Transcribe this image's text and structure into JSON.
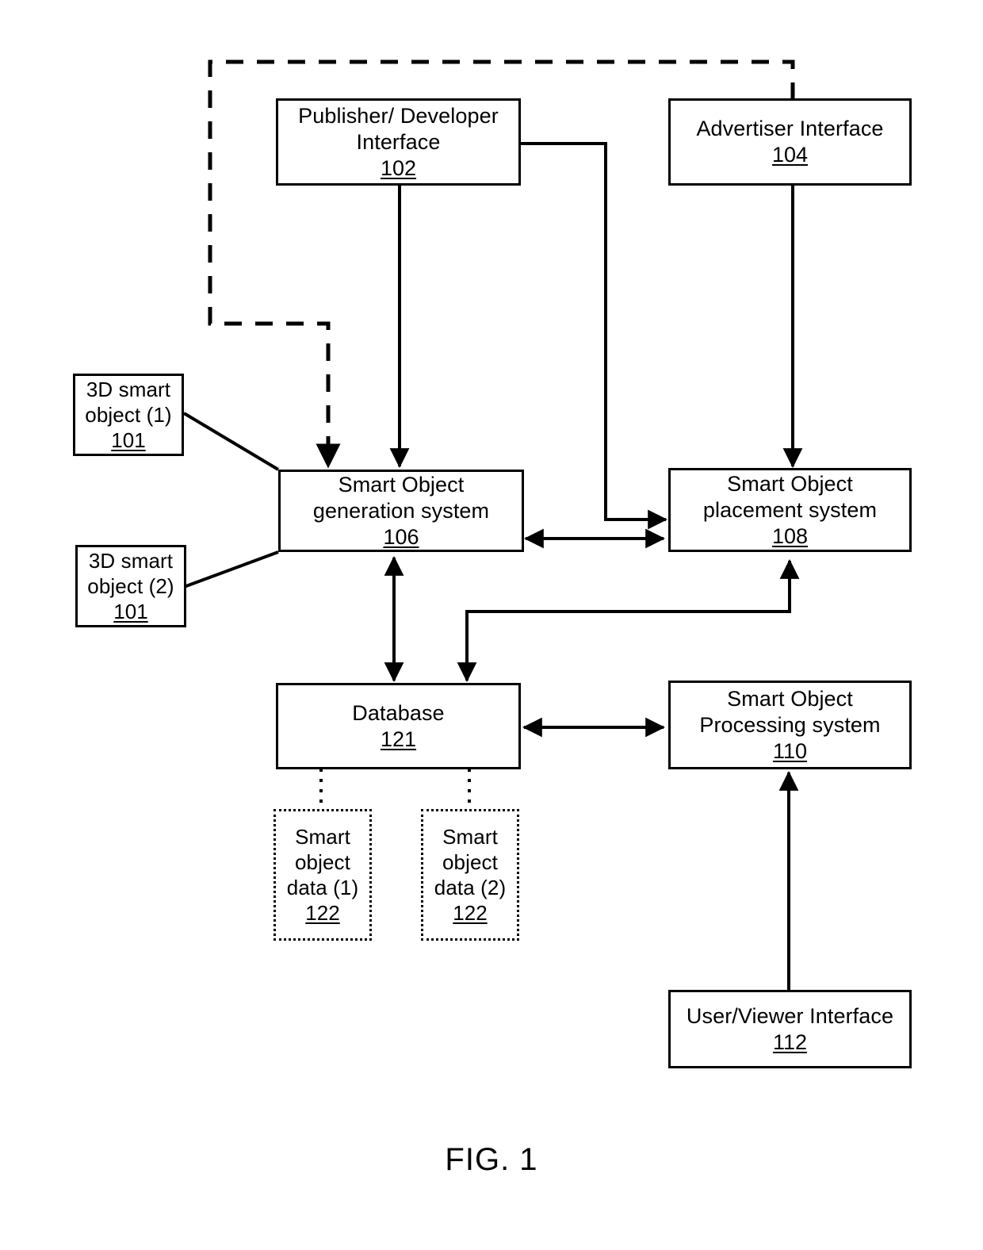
{
  "figure": {
    "caption": "FIG. 1",
    "background_color": "#ffffff",
    "line_color": "#000000"
  },
  "nodes": {
    "publisher_developer_interface": {
      "title": "Publisher/ Developer\nInterface",
      "ref": "102",
      "border_style": "solid"
    },
    "advertiser_interface": {
      "title": "Advertiser Interface",
      "ref": "104",
      "border_style": "solid"
    },
    "smart_object_1": {
      "title": "3D smart\nobject (1)",
      "ref": "101",
      "border_style": "solid"
    },
    "smart_object_2": {
      "title": "3D smart\nobject (2)",
      "ref": "101",
      "border_style": "solid"
    },
    "smart_object_generation_system": {
      "title": "Smart Object\ngeneration system",
      "ref": "106",
      "border_style": "solid"
    },
    "smart_object_placement_system": {
      "title": "Smart Object\nplacement system",
      "ref": "108",
      "border_style": "solid"
    },
    "database": {
      "title": "Database",
      "ref": "121",
      "border_style": "solid"
    },
    "smart_object_processing_system": {
      "title": "Smart Object\nProcessing system",
      "ref": "110",
      "border_style": "solid"
    },
    "user_viewer_interface": {
      "title": "User/Viewer Interface",
      "ref": "112",
      "border_style": "solid"
    },
    "smart_object_data_1": {
      "title": "Smart\nobject\ndata (1)",
      "ref": "122",
      "border_style": "dotted"
    },
    "smart_object_data_2": {
      "title": "Smart\nobject\ndata (2)",
      "ref": "122",
      "border_style": "dotted"
    }
  },
  "connections": [
    {
      "name": "advertiser-to-generation-feedback",
      "from": "advertiser_interface",
      "to": "smart_object_generation_system",
      "style": "dashed",
      "arrow": "single"
    },
    {
      "name": "publisher-to-generation",
      "from": "publisher_developer_interface",
      "to": "smart_object_generation_system",
      "style": "solid",
      "arrow": "single"
    },
    {
      "name": "publisher-to-placement",
      "from": "publisher_developer_interface",
      "to": "smart_object_placement_system",
      "style": "solid",
      "arrow": "single"
    },
    {
      "name": "advertiser-to-placement",
      "from": "advertiser_interface",
      "to": "smart_object_placement_system",
      "style": "solid",
      "arrow": "single"
    },
    {
      "name": "smart-object-1-to-generation",
      "from": "smart_object_1",
      "to": "smart_object_generation_system",
      "style": "solid",
      "arrow": "none"
    },
    {
      "name": "smart-object-2-to-generation",
      "from": "smart_object_2",
      "to": "smart_object_generation_system",
      "style": "solid",
      "arrow": "none"
    },
    {
      "name": "generation-placement-link",
      "from": "smart_object_generation_system",
      "to": "smart_object_placement_system",
      "style": "solid",
      "arrow": "double"
    },
    {
      "name": "generation-database-link",
      "from": "smart_object_generation_system",
      "to": "database",
      "style": "solid",
      "arrow": "double"
    },
    {
      "name": "database-placement-link",
      "from": "database",
      "to": "smart_object_placement_system",
      "style": "solid",
      "arrow": "single"
    },
    {
      "name": "database-processing-link",
      "from": "database",
      "to": "smart_object_processing_system",
      "style": "solid",
      "arrow": "double"
    },
    {
      "name": "user-viewer-to-processing",
      "from": "user_viewer_interface",
      "to": "smart_object_processing_system",
      "style": "solid",
      "arrow": "single"
    },
    {
      "name": "database-to-data-1",
      "from": "database",
      "to": "smart_object_data_1",
      "style": "dotted",
      "arrow": "none"
    },
    {
      "name": "database-to-data-2",
      "from": "database",
      "to": "smart_object_data_2",
      "style": "dotted",
      "arrow": "none"
    }
  ]
}
